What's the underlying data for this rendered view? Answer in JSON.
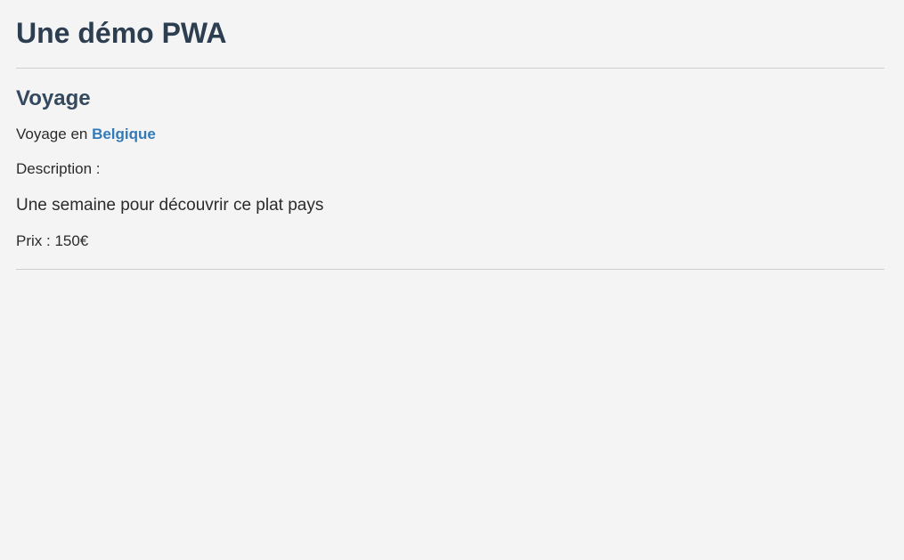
{
  "header": {
    "title": "Une démo PWA"
  },
  "trip": {
    "title": "Voyage",
    "country_prefix": "Voyage en ",
    "country": "Belgique",
    "description_label": "Description :",
    "description": "Une semaine pour découvrir ce plat pays",
    "price": "Prix : 150€"
  },
  "colors": {
    "background": "#f4f4f4",
    "title": "#2c3e50",
    "link": "#337ab7"
  }
}
